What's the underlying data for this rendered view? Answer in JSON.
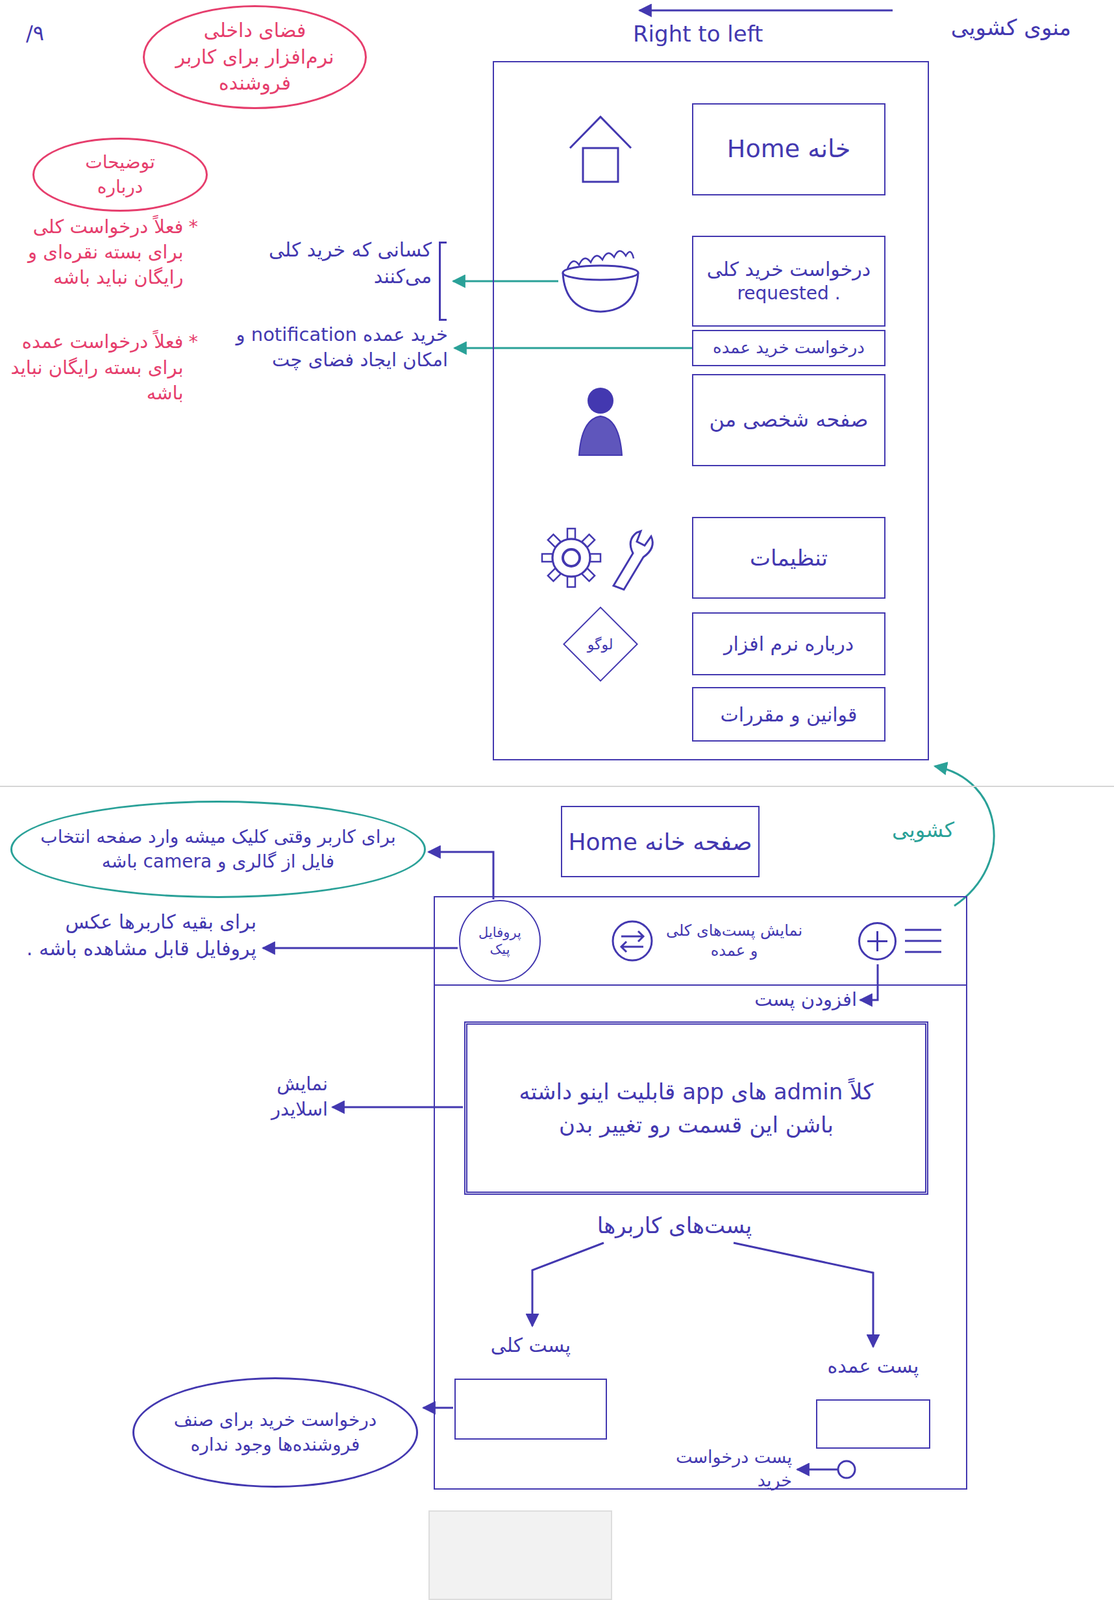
{
  "date": "۹/",
  "header": {
    "title": "فضای داخلی نرم‌افزار برای کاربر فروشنده",
    "drawer_label": "منوی کشویی",
    "direction": "Right to left"
  },
  "notes": {
    "title": "توضیحات درباره",
    "items": [
      {
        "bullet": "*",
        "text": "فعلاً درخواست کلی برای بسته نقره‌ای و رایگان نباید باشه"
      },
      {
        "bullet": "*",
        "text": "فعلاً درخواست عمده برای بسته رایگان نباید باشه"
      }
    ]
  },
  "drawer": {
    "items": [
      {
        "label": "خانه Home",
        "kind": "home"
      },
      {
        "label": "درخواست خرید کلی",
        "sub": "requested .",
        "kind": "basket"
      },
      {
        "label": "درخواست خرید عمده",
        "kind": "plain"
      },
      {
        "label": "صفحه شخصی من",
        "kind": "person"
      },
      {
        "label": "تنظیمات",
        "kind": "gear"
      },
      {
        "label": "درباره نرم افزار",
        "kind": "logo",
        "logo": "لوگو"
      },
      {
        "label": "قوانین و مقررات",
        "kind": "plain"
      }
    ],
    "annotations": [
      {
        "text": "کسانی که خرید کلی می‌کنند"
      },
      {
        "text": "خرید عمده notification و امکان ایجاد فضای چت"
      }
    ]
  },
  "home": {
    "label": "صفحه خانه Home",
    "drawer_link": "کشویی",
    "toolbar": {
      "profile": "پروفایل پیک",
      "toggle_hint": "نمایش پست‌های کلی و عمده",
      "add_hint": "افزودن پست"
    },
    "profile_note": "برای کاربر وقتی کلیک میشه وارد صفحه انتخاب فایل از گالری و camera باشه",
    "profile_others_note": "برای بقیه کاربرها عکس پروفایل قابل مشاهده باشه .",
    "slider": {
      "text": "کلاً admin های app قابلیت اینو داشته باشن این قسمت رو تغییر بدن",
      "hint": "نمایش اسلایدر"
    },
    "posts": {
      "title": "پست‌های کاربرها",
      "items": [
        {
          "label": "پست کلی",
          "note": "درخواست خرید برای صنف فروشنده‌ها وجود نداره"
        },
        {
          "label": "پست عمده",
          "note": "پست درخواست خرید"
        }
      ]
    }
  }
}
